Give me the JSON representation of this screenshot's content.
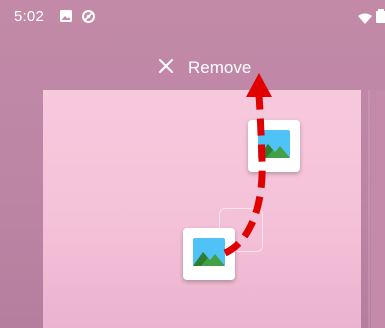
{
  "status_bar": {
    "time": "5:02",
    "icons": [
      "image-icon",
      "sync-icon",
      "wifi-icon",
      "battery-icon"
    ]
  },
  "drop_target": {
    "icon": "close-icon",
    "label": "Remove"
  },
  "dragged_item": {
    "icon": "image-placeholder-icon"
  },
  "source_item": {
    "icon": "image-placeholder-icon"
  },
  "overlay": {
    "arrow_color": "#e00000",
    "arrow_style": "dashed"
  },
  "colors": {
    "scrim": "#c28aa7",
    "page_card": "#f6c6db",
    "icon_mountain_green": "#43a047",
    "icon_sky_blue": "#4fc3f7"
  }
}
